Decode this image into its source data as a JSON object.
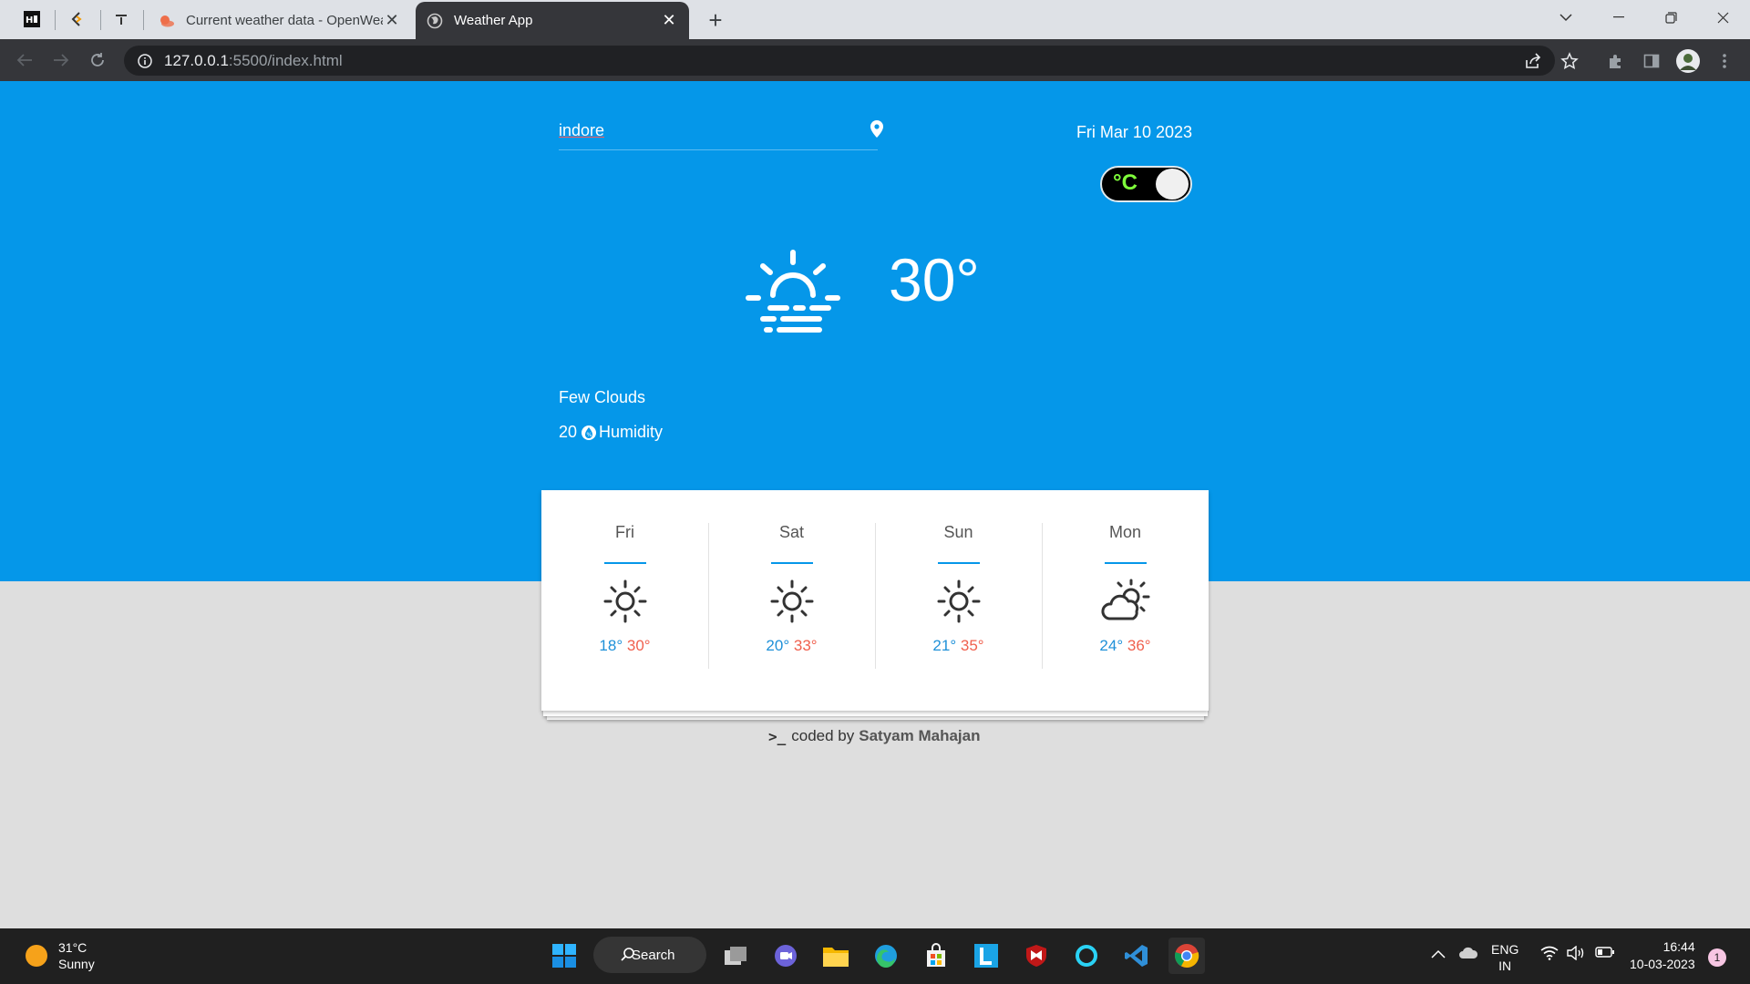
{
  "browser": {
    "tabs": [
      {
        "title": "Current weather data - OpenWeather",
        "active": false
      },
      {
        "title": "Weather App",
        "active": true
      }
    ],
    "url_host": "127.0.0.1",
    "url_path": ":5500/index.html",
    "accent": "#35363a"
  },
  "app": {
    "search_value": "indore",
    "date": "Fri Mar 10 2023",
    "unit_label": "°C",
    "current_temp": "30°",
    "condition": "Few Clouds",
    "humidity_value": "20",
    "humidity_label": "Humidity",
    "hero_color": "#0597e9",
    "forecast": [
      {
        "day": "Fri",
        "low": "18°",
        "high": "30°",
        "icon": "sun-icon"
      },
      {
        "day": "Sat",
        "low": "20°",
        "high": "33°",
        "icon": "sun-icon"
      },
      {
        "day": "Sun",
        "low": "21°",
        "high": "35°",
        "icon": "sun-icon"
      },
      {
        "day": "Mon",
        "low": "24°",
        "high": "36°",
        "icon": "partly-cloudy-icon"
      }
    ],
    "credit_prefix": "coded by",
    "credit_author": "Satyam Mahajan"
  },
  "taskbar": {
    "weather_temp": "31°C",
    "weather_cond": "Sunny",
    "search_label": "Search",
    "lang_top": "ENG",
    "lang_bottom": "IN",
    "time": "16:44",
    "date": "10-03-2023",
    "notifications": "1"
  }
}
